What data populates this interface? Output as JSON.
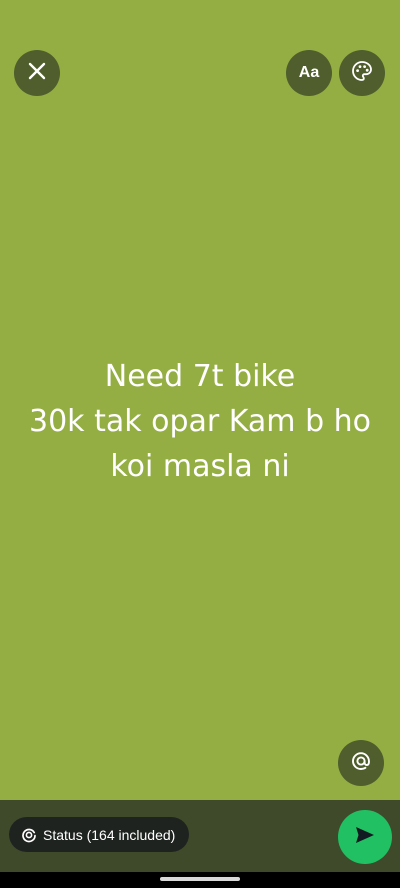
{
  "toolbar": {
    "font_label": "Aa",
    "icons": {
      "close": "close-icon",
      "palette": "palette-icon",
      "mention": "at-sign-icon"
    }
  },
  "status": {
    "lines": [
      "Need 7t bike",
      "30k tak opar Kam b ho",
      "koi masla ni"
    ],
    "background_color": "#94ae44",
    "text_color": "#ffffff"
  },
  "bottom_bar": {
    "audience_label": "Status (164 included)",
    "audience_icon": "status-ring-icon",
    "send_icon": "send-icon",
    "send_color": "#21c063"
  }
}
